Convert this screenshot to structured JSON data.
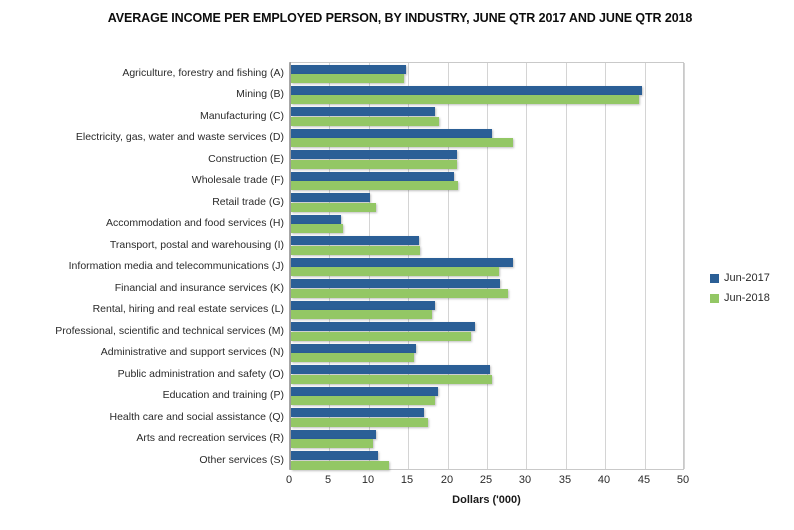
{
  "chart_data": {
    "type": "bar",
    "orientation": "horizontal",
    "title": "AVERAGE INCOME PER EMPLOYED PERSON, BY INDUSTRY, JUNE QTR 2017 AND JUNE QTR 2018",
    "xlabel": "Dollars ('000)",
    "ylabel": "",
    "xlim": [
      0,
      50
    ],
    "xticks": [
      0,
      5,
      10,
      15,
      20,
      25,
      30,
      35,
      40,
      45,
      50
    ],
    "grid": true,
    "legend_position": "right",
    "categories": [
      "Agriculture, forestry and fishing (A)",
      "Mining (B)",
      "Manufacturing (C)",
      "Electricity, gas, water and waste services (D)",
      "Construction (E)",
      "Wholesale trade (F)",
      "Retail trade (G)",
      "Accommodation and food services (H)",
      "Transport, postal and warehousing (I)",
      "Information media and telecommunications (J)",
      "Financial and insurance services (K)",
      "Rental, hiring and real estate services (L)",
      "Professional, scientific and technical services (M)",
      "Administrative and support services (N)",
      "Public administration and safety (O)",
      "Education and training (P)",
      "Health care and social assistance (Q)",
      "Arts and recreation services (R)",
      "Other services (S)"
    ],
    "series": [
      {
        "name": "Jun-2017",
        "color": "#2b5f96",
        "values": [
          14.6,
          44.5,
          18.3,
          25.5,
          21.1,
          20.7,
          10.0,
          6.4,
          16.3,
          28.2,
          26.5,
          18.3,
          23.3,
          15.8,
          25.3,
          18.7,
          16.9,
          10.8,
          11.0
        ]
      },
      {
        "name": "Jun-2018",
        "color": "#93c765",
        "values": [
          14.3,
          44.2,
          18.8,
          28.2,
          21.1,
          21.2,
          10.8,
          6.6,
          16.4,
          26.4,
          27.5,
          17.9,
          22.8,
          15.6,
          25.5,
          18.3,
          17.4,
          10.4,
          12.4
        ]
      }
    ]
  },
  "legend": {
    "items": [
      {
        "label": "Jun-2017",
        "color": "#2b5f96"
      },
      {
        "label": "Jun-2018",
        "color": "#93c765"
      }
    ]
  }
}
